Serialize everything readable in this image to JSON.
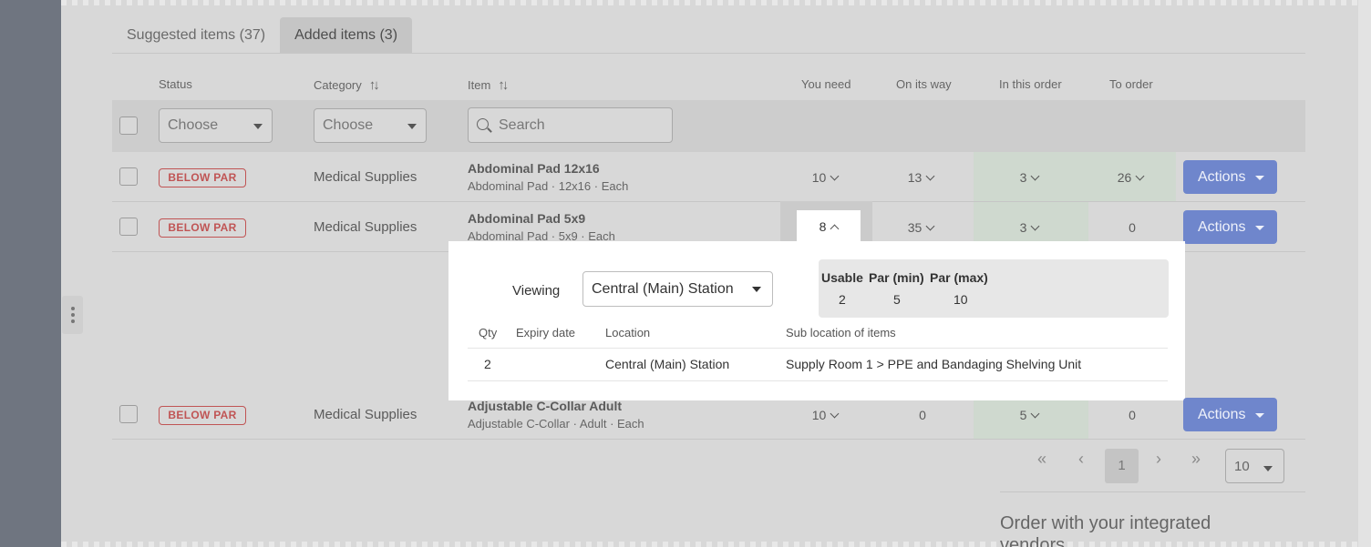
{
  "tabs": [
    {
      "label": "Suggested items (37)",
      "active": false
    },
    {
      "label": "Added items (3)",
      "active": true
    }
  ],
  "columns": {
    "status": "Status",
    "category": "Category",
    "item": "Item",
    "you_need": "You need",
    "on_its_way": "On its way",
    "in_this_order": "In this order",
    "to_order": "To order"
  },
  "filters": {
    "status_placeholder": "Choose",
    "category_placeholder": "Choose",
    "search_placeholder": "Search"
  },
  "rows": [
    {
      "status": "BELOW PAR",
      "category": "Medical Supplies",
      "name": "Abdominal Pad 12x16",
      "sub": "Abdominal Pad · 12x16 · Each",
      "you_need": "10",
      "on_its_way": "13",
      "in_this_order": "3",
      "to_order": "26",
      "action": "Actions"
    },
    {
      "status": "BELOW PAR",
      "category": "Medical Supplies",
      "name": "Abdominal Pad 5x9",
      "sub": "Abdominal Pad · 5x9 · Each",
      "you_need": "8",
      "on_its_way": "35",
      "in_this_order": "3",
      "to_order": "0",
      "action": "Actions"
    },
    {
      "status": "BELOW PAR",
      "category": "Medical Supplies",
      "name": "Adjustable C-Collar Adult",
      "sub": "Adjustable C-Collar · Adult · Each",
      "you_need": "10",
      "on_its_way": "0",
      "in_this_order": "5",
      "to_order": "0",
      "action": "Actions"
    }
  ],
  "popover": {
    "viewing_label": "Viewing",
    "viewing_value": "Central (Main) Station",
    "par_headers": [
      "Usable",
      "Par (min)",
      "Par (max)"
    ],
    "par_values": [
      "2",
      "5",
      "10"
    ],
    "table_headers": {
      "qty": "Qty",
      "expiry": "Expiry date",
      "location": "Location",
      "sub_location": "Sub location of items"
    },
    "table_row": {
      "qty": "2",
      "expiry": "",
      "location": "Central (Main) Station",
      "sub_location": "Supply Room 1 > PPE and Bandaging Shelving Unit"
    }
  },
  "pagination": {
    "first": "«",
    "prev": "‹",
    "current": "1",
    "next": "›",
    "last": "»",
    "per_page": "10"
  },
  "vendors_title": "Order with your integrated vendors",
  "colors": {
    "accent": "#6f86cc",
    "badge": "#c05454",
    "green_col": "#cfd9cf"
  }
}
